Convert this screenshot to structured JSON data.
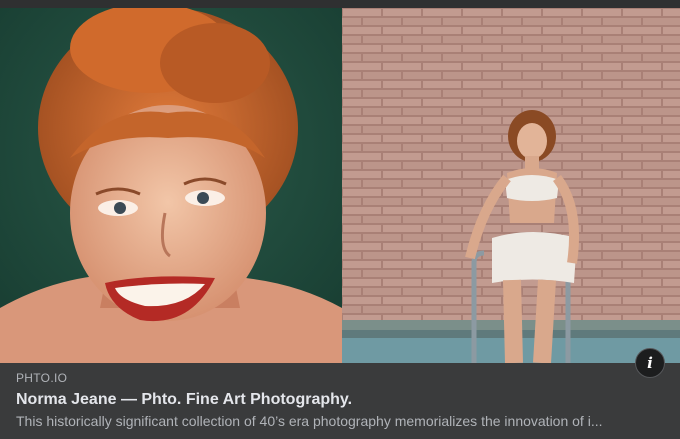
{
  "link_preview": {
    "domain": "PHTO.IO",
    "title": "Norma Jeane — Phto. Fine Art Photography.",
    "description": "This historically significant collection of 40’s era photography memorializes the innovation of i...",
    "images": [
      {
        "icon": "portrait-photo-icon"
      },
      {
        "icon": "poolside-photo-icon"
      }
    ],
    "info_button": {
      "glyph": "i",
      "icon": "info-icon"
    }
  },
  "colors": {
    "card_background": "#3a3b3c",
    "title_text": "#e4e6eb",
    "secondary_text": "#b0b3b8",
    "portrait_background": "#1f4a3c",
    "brick_wall": "#b79389",
    "hair": "#c0622a"
  }
}
